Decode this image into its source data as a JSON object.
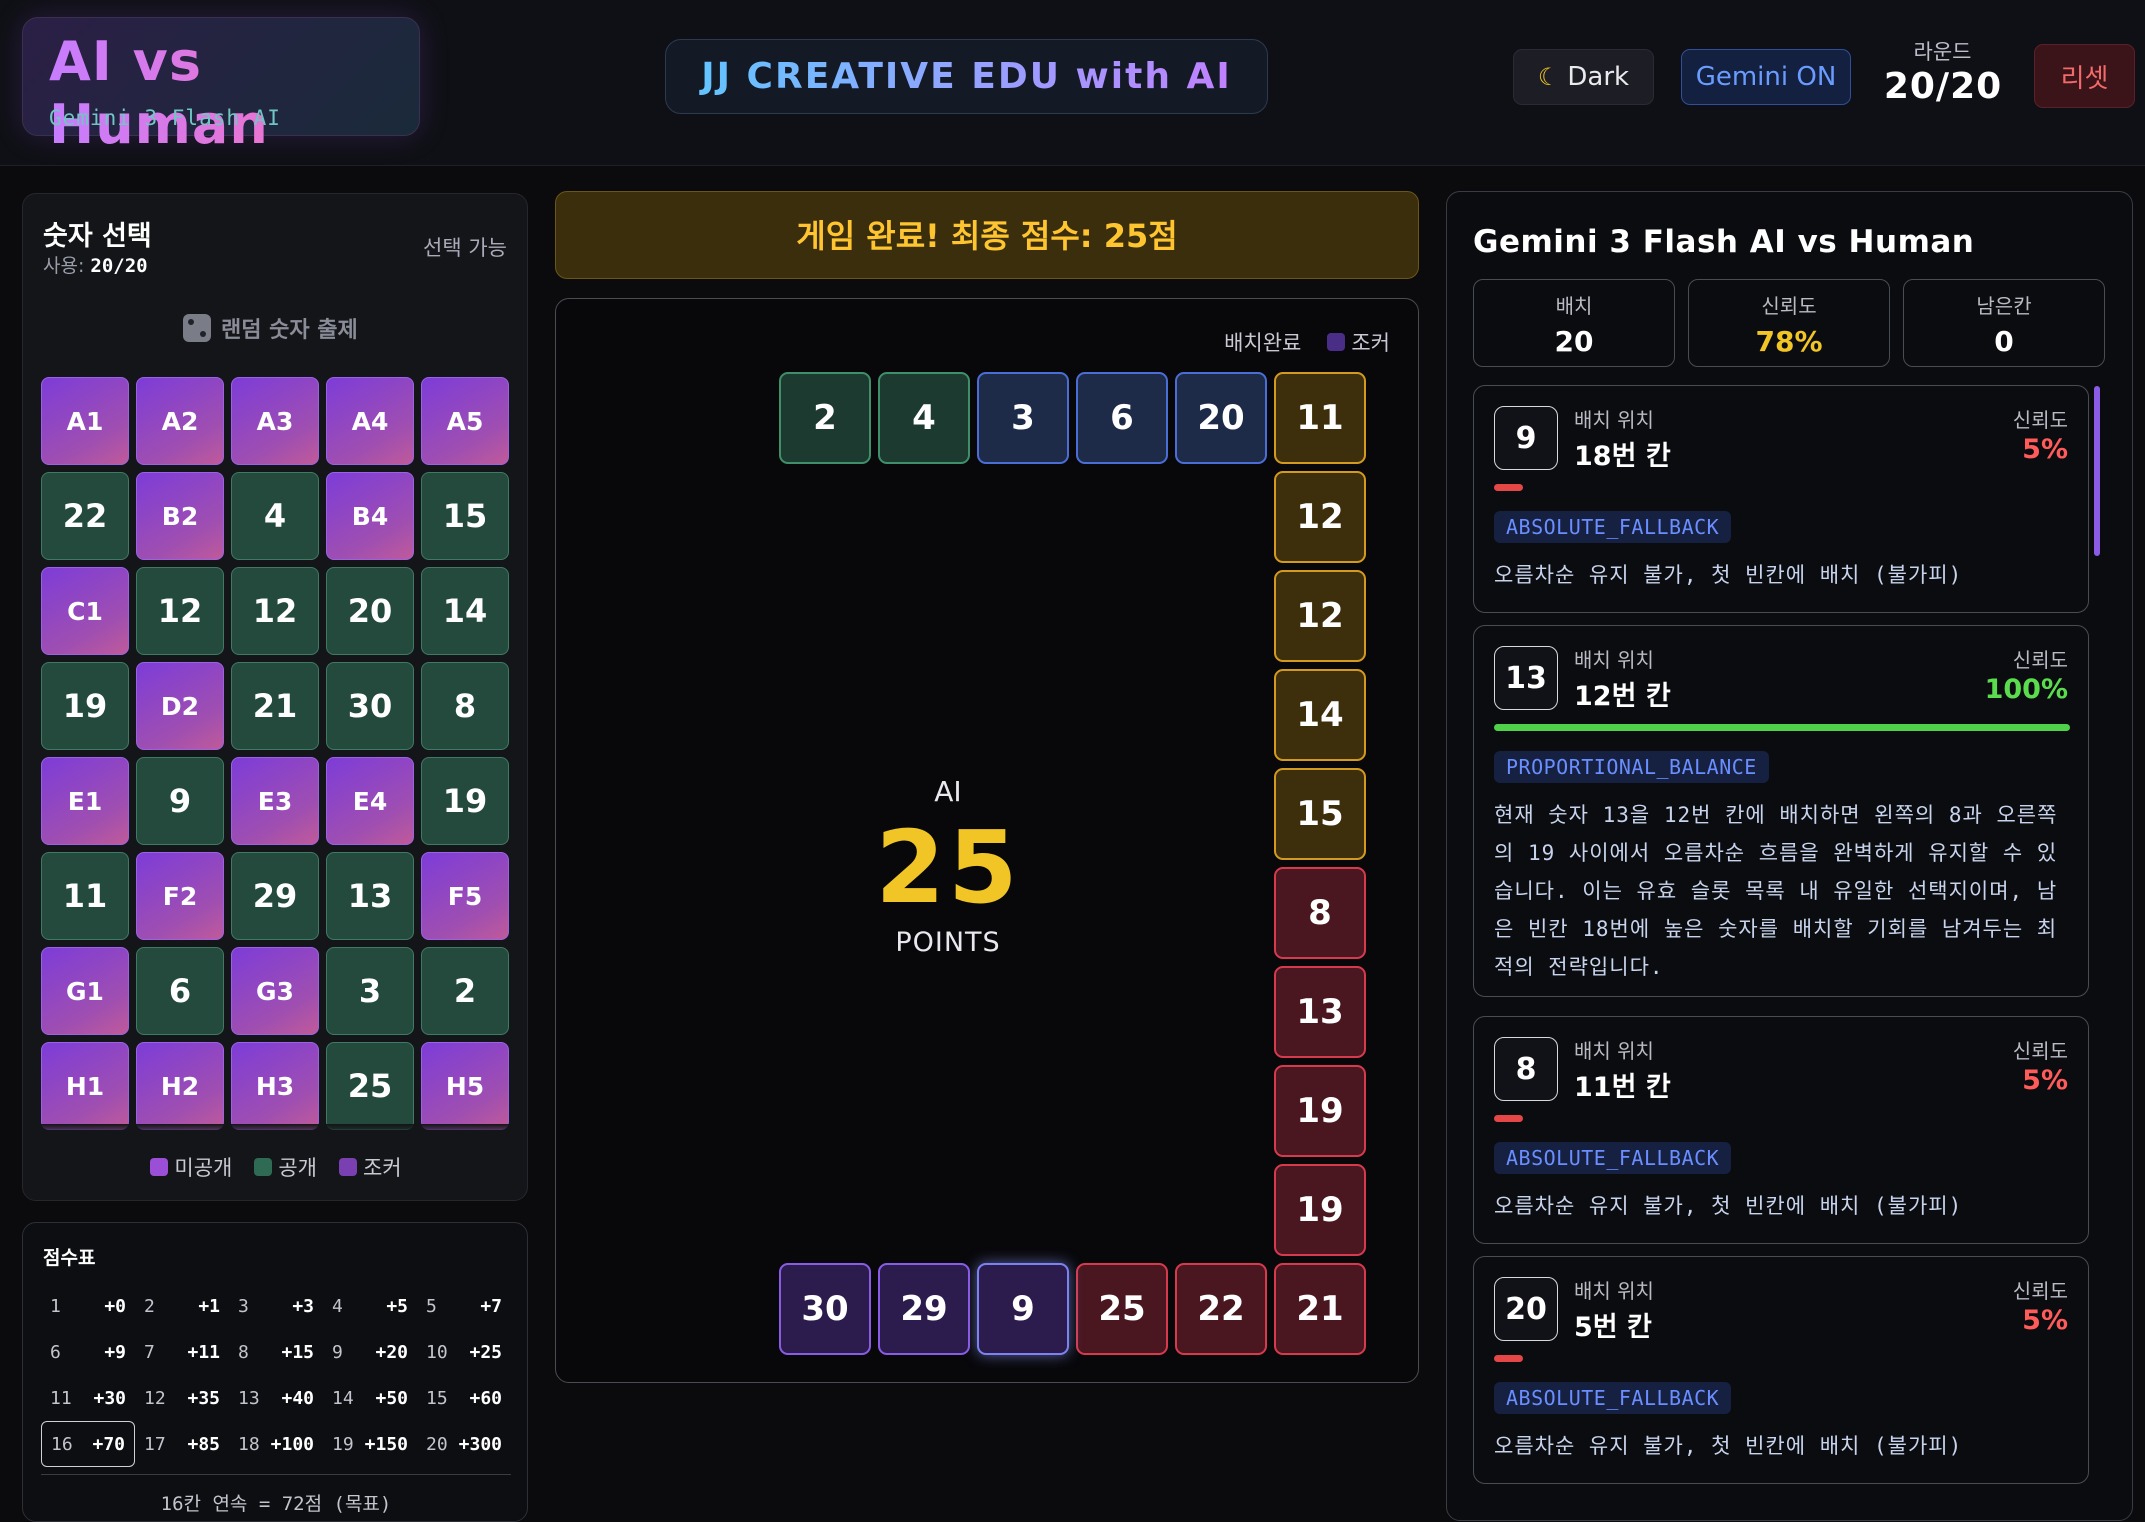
{
  "header": {
    "brand_title": "AI vs Human",
    "brand_subtitle": "Gemini 3 Flash AI",
    "banner": "JJ CREATIVE EDU with AI",
    "theme_icon": "moon-icon",
    "theme_label": "Dark",
    "gemini_label": "Gemini ON",
    "round_label": "라운드",
    "round_value": "20/20",
    "reset_label": "리셋"
  },
  "number_panel": {
    "title": "숫자 선택",
    "usage_label": "사용:",
    "usage_value": "20/20",
    "status": "선택 가능",
    "random_label": "랜덤 숫자 출제",
    "cards": [
      {
        "label": "A1",
        "state": "hidden"
      },
      {
        "label": "A2",
        "state": "hidden"
      },
      {
        "label": "A3",
        "state": "hidden"
      },
      {
        "label": "A4",
        "state": "hidden"
      },
      {
        "label": "A5",
        "state": "hidden"
      },
      {
        "label": "22",
        "state": "open"
      },
      {
        "label": "B2",
        "state": "hidden"
      },
      {
        "label": "4",
        "state": "open"
      },
      {
        "label": "B4",
        "state": "hidden"
      },
      {
        "label": "15",
        "state": "open"
      },
      {
        "label": "C1",
        "state": "hidden"
      },
      {
        "label": "12",
        "state": "open"
      },
      {
        "label": "12",
        "state": "open"
      },
      {
        "label": "20",
        "state": "open"
      },
      {
        "label": "14",
        "state": "open"
      },
      {
        "label": "19",
        "state": "open"
      },
      {
        "label": "D2",
        "state": "hidden"
      },
      {
        "label": "21",
        "state": "open"
      },
      {
        "label": "30",
        "state": "open"
      },
      {
        "label": "8",
        "state": "open"
      },
      {
        "label": "E1",
        "state": "hidden"
      },
      {
        "label": "9",
        "state": "open"
      },
      {
        "label": "E3",
        "state": "hidden"
      },
      {
        "label": "E4",
        "state": "hidden"
      },
      {
        "label": "19",
        "state": "open"
      },
      {
        "label": "11",
        "state": "open"
      },
      {
        "label": "F2",
        "state": "hidden"
      },
      {
        "label": "29",
        "state": "open"
      },
      {
        "label": "13",
        "state": "open"
      },
      {
        "label": "F5",
        "state": "hidden"
      },
      {
        "label": "G1",
        "state": "hidden"
      },
      {
        "label": "6",
        "state": "open"
      },
      {
        "label": "G3",
        "state": "hidden"
      },
      {
        "label": "3",
        "state": "open"
      },
      {
        "label": "2",
        "state": "open"
      },
      {
        "label": "H1",
        "state": "hidden"
      },
      {
        "label": "H2",
        "state": "hidden"
      },
      {
        "label": "H3",
        "state": "hidden"
      },
      {
        "label": "25",
        "state": "open"
      },
      {
        "label": "H5",
        "state": "hidden"
      }
    ],
    "legend": [
      {
        "label": "미공개",
        "color": "#9b4fd6"
      },
      {
        "label": "공개",
        "color": "#2f6a55"
      },
      {
        "label": "조커",
        "color": "#7a3fb0"
      }
    ]
  },
  "score_table": {
    "title": "점수표",
    "entries": [
      {
        "n": "1",
        "pts": "+0"
      },
      {
        "n": "2",
        "pts": "+1"
      },
      {
        "n": "3",
        "pts": "+3"
      },
      {
        "n": "4",
        "pts": "+5"
      },
      {
        "n": "5",
        "pts": "+7"
      },
      {
        "n": "6",
        "pts": "+9"
      },
      {
        "n": "7",
        "pts": "+11"
      },
      {
        "n": "8",
        "pts": "+15"
      },
      {
        "n": "9",
        "pts": "+20"
      },
      {
        "n": "10",
        "pts": "+25"
      },
      {
        "n": "11",
        "pts": "+30"
      },
      {
        "n": "12",
        "pts": "+35"
      },
      {
        "n": "13",
        "pts": "+40"
      },
      {
        "n": "14",
        "pts": "+50"
      },
      {
        "n": "15",
        "pts": "+60"
      },
      {
        "n": "16",
        "pts": "+70",
        "highlight": true
      },
      {
        "n": "17",
        "pts": "+85"
      },
      {
        "n": "18",
        "pts": "+100"
      },
      {
        "n": "19",
        "pts": "+150"
      },
      {
        "n": "20",
        "pts": "+300"
      }
    ],
    "note": "16칸 연속 = 72점 (목표)"
  },
  "status": {
    "message": "게임 완료! 최종 점수: 25점"
  },
  "board": {
    "legend": [
      {
        "label": "배치완료",
        "color": null
      },
      {
        "label": "조커",
        "color": "#4a2d86"
      }
    ],
    "player_label": "AI",
    "score": "25",
    "score_unit": "POINTS",
    "tiles": [
      {
        "value": "2",
        "style": "green"
      },
      {
        "value": "4",
        "style": "green"
      },
      {
        "value": "3",
        "style": "blue"
      },
      {
        "value": "6",
        "style": "blue"
      },
      {
        "value": "20",
        "style": "blue"
      },
      {
        "value": "11",
        "style": "gold"
      },
      {
        "value": "12",
        "style": "gold"
      },
      {
        "value": "12",
        "style": "gold"
      },
      {
        "value": "14",
        "style": "gold"
      },
      {
        "value": "15",
        "style": "gold"
      },
      {
        "value": "8",
        "style": "red"
      },
      {
        "value": "13",
        "style": "red"
      },
      {
        "value": "19",
        "style": "red"
      },
      {
        "value": "19",
        "style": "red"
      },
      {
        "value": "21",
        "style": "red"
      },
      {
        "value": "22",
        "style": "red"
      },
      {
        "value": "25",
        "style": "red"
      },
      {
        "value": "9",
        "style": "purple-glow"
      },
      {
        "value": "29",
        "style": "purple"
      },
      {
        "value": "30",
        "style": "purple"
      }
    ]
  },
  "ai_panel": {
    "title": "Gemini 3 Flash AI vs Human",
    "stats": [
      {
        "label": "배치",
        "value": "20"
      },
      {
        "label": "신뢰도",
        "value": "78%"
      },
      {
        "label": "남은칸",
        "value": "0"
      }
    ],
    "decisions": [
      {
        "number": "9",
        "pos_label": "배치 위치",
        "pos": "18번 칸",
        "conf_label": "신뢰도",
        "conf": "5%",
        "conf_level": 0.05,
        "tag": "ABSOLUTE_FALLBACK",
        "text": "오름차순 유지 불가, 첫 빈칸에 배치 (불가피)"
      },
      {
        "number": "13",
        "pos_label": "배치 위치",
        "pos": "12번 칸",
        "conf_label": "신뢰도",
        "conf": "100%",
        "conf_level": 1.0,
        "tag": "PROPORTIONAL_BALANCE",
        "text": "현재 숫자 13을 12번 칸에 배치하면 왼쪽의 8과 오른쪽의 19 사이에서 오름차순 흐름을 완벽하게 유지할 수 있습니다. 이는 유효 슬롯 목록 내 유일한 선택지이며, 남은 빈칸 18번에 높은 숫자를 배치할 기회를 남겨두는 최적의 전략입니다."
      },
      {
        "number": "8",
        "pos_label": "배치 위치",
        "pos": "11번 칸",
        "conf_label": "신뢰도",
        "conf": "5%",
        "conf_level": 0.05,
        "tag": "ABSOLUTE_FALLBACK",
        "text": "오름차순 유지 불가, 첫 빈칸에 배치 (불가피)"
      },
      {
        "number": "20",
        "pos_label": "배치 위치",
        "pos": "5번 칸",
        "conf_label": "신뢰도",
        "conf": "5%",
        "conf_level": 0.05,
        "tag": "ABSOLUTE_FALLBACK",
        "text": "오름차순 유지 불가, 첫 빈칸에 배치 (불가피)"
      }
    ]
  }
}
